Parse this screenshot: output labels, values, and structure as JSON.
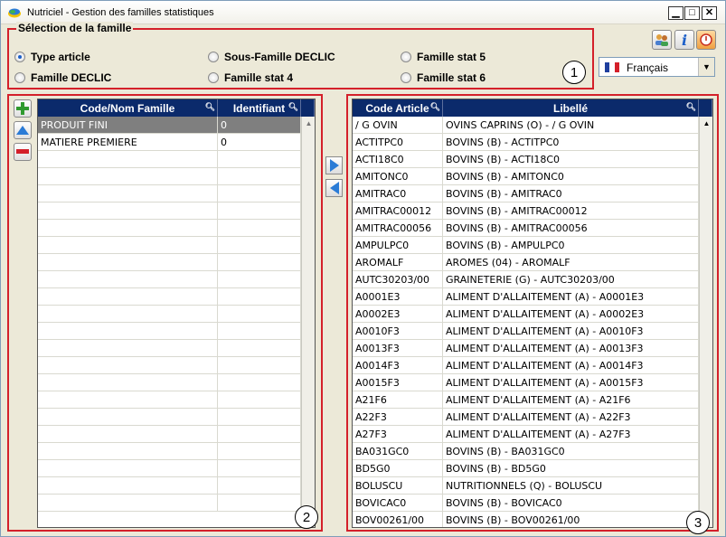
{
  "window": {
    "title": "Nutriciel - Gestion des familles statistiques"
  },
  "colors": {
    "highlight": "#d4202a",
    "grid_header": "#0b2a6b",
    "selected_row": "#7f7f7f"
  },
  "selection": {
    "legend": "Sélection de la famille",
    "badge": "1",
    "options": [
      {
        "label": "Type article",
        "selected": true
      },
      {
        "label": "Sous-Famille DECLIC",
        "selected": false
      },
      {
        "label": "Famille stat 5",
        "selected": false
      },
      {
        "label": "Famille DECLIC",
        "selected": false
      },
      {
        "label": "Famille stat 4",
        "selected": false
      },
      {
        "label": "Famille stat 6",
        "selected": false
      }
    ]
  },
  "language": {
    "value": "Français"
  },
  "left_grid": {
    "badge": "2",
    "columns": [
      "Code/Nom Famille",
      "Identifiant"
    ],
    "rows": [
      {
        "name": "PRODUIT FINI",
        "id": "0"
      },
      {
        "name": "MATIERE PREMIERE",
        "id": "0"
      }
    ]
  },
  "right_grid": {
    "badge": "3",
    "columns": [
      "Code Article",
      "Libellé"
    ],
    "rows": [
      {
        "code": "/ G OVIN",
        "label": "OVINS CAPRINS (O) - / G OVIN"
      },
      {
        "code": "ACTITPC0",
        "label": "BOVINS (B) - ACTITPC0"
      },
      {
        "code": "ACTI18C0",
        "label": "BOVINS (B) - ACTI18C0"
      },
      {
        "code": "AMITONC0",
        "label": "BOVINS (B) - AMITONC0"
      },
      {
        "code": "AMITRAC0",
        "label": "BOVINS (B) - AMITRAC0"
      },
      {
        "code": "AMITRAC00012",
        "label": "BOVINS (B) - AMITRAC00012"
      },
      {
        "code": "AMITRAC00056",
        "label": "BOVINS (B) - AMITRAC00056"
      },
      {
        "code": "AMPULPC0",
        "label": "BOVINS (B) - AMPULPC0"
      },
      {
        "code": "AROMALF",
        "label": "AROMES (04) - AROMALF"
      },
      {
        "code": "AUTC30203/00",
        "label": "GRAINETERIE (G) - AUTC30203/00"
      },
      {
        "code": "A0001E3",
        "label": "ALIMENT D'ALLAITEMENT (A) - A0001E3"
      },
      {
        "code": "A0002E3",
        "label": "ALIMENT D'ALLAITEMENT (A) - A0002E3"
      },
      {
        "code": "A0010F3",
        "label": "ALIMENT D'ALLAITEMENT (A) - A0010F3"
      },
      {
        "code": "A0013F3",
        "label": "ALIMENT D'ALLAITEMENT (A) - A0013F3"
      },
      {
        "code": "A0014F3",
        "label": "ALIMENT D'ALLAITEMENT (A) - A0014F3"
      },
      {
        "code": "A0015F3",
        "label": "ALIMENT D'ALLAITEMENT (A) - A0015F3"
      },
      {
        "code": "A21F6",
        "label": "ALIMENT D'ALLAITEMENT (A) - A21F6"
      },
      {
        "code": "A22F3",
        "label": "ALIMENT D'ALLAITEMENT (A) - A22F3"
      },
      {
        "code": "A27F3",
        "label": "ALIMENT D'ALLAITEMENT (A) - A27F3"
      },
      {
        "code": "BA031GC0",
        "label": "BOVINS (B) - BA031GC0"
      },
      {
        "code": "BD5G0",
        "label": "BOVINS (B) - BD5G0"
      },
      {
        "code": "BOLUSCU",
        "label": "NUTRITIONNELS (Q) - BOLUSCU"
      },
      {
        "code": "BOVICAC0",
        "label": "BOVINS (B) - BOVICAC0"
      },
      {
        "code": "BOV00261/00",
        "label": "BOVINS (B) - BOV00261/00"
      }
    ]
  }
}
